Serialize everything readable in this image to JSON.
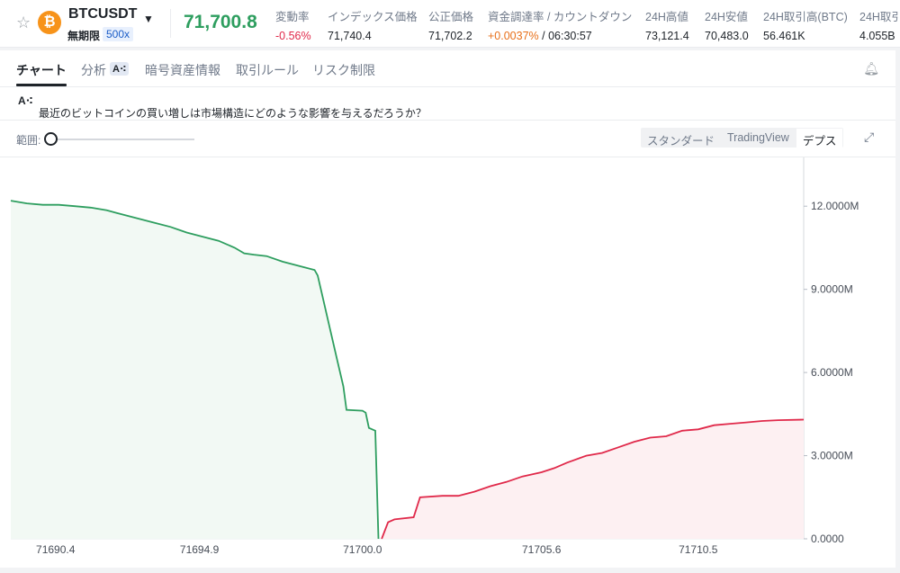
{
  "header": {
    "symbol": "BTCUSDT",
    "contract": "無期限",
    "leverage": "500x",
    "coin_letter": "₿",
    "last_price": "71,700.8",
    "stats": [
      {
        "label": "変動率",
        "value": "-0.56%"
      },
      {
        "label": "インデックス価格",
        "value": "71,740.4"
      },
      {
        "label": "公正価格",
        "value": "71,702.2"
      },
      {
        "label": "資金調達率 / カウントダウン",
        "value": "+0.0037%",
        "value2": " / 06:30:57"
      },
      {
        "label": "24H高値",
        "value": "73,121.4"
      },
      {
        "label": "24H安値",
        "value": "70,483.0"
      },
      {
        "label": "24H取引高(BTC)",
        "value": "56.461K"
      },
      {
        "label": "24H取引",
        "value": "4.055B"
      }
    ]
  },
  "tabs": [
    "チャート",
    "分析",
    "暗号資産情報",
    "取引ルール",
    "リスク制限"
  ],
  "ai_badge": "A⁖",
  "ai_question": "最近のビットコインの買い増しは市場構造にどのような影響を与えるだろうか？",
  "range_label": "範囲:",
  "view_modes": [
    "スタンダード",
    "TradingView",
    "デプス"
  ],
  "active_view": "デプス",
  "colors": {
    "bid": "#2e9e5f",
    "ask": "#e0294a",
    "bid_fill": "#f2f9f4",
    "ask_fill": "#fdf0f2"
  },
  "chart_data": {
    "type": "area",
    "title": "",
    "xlabel": "",
    "ylabel": "",
    "x_ticks": [
      "71690.4",
      "71694.9",
      "71700.0",
      "71705.6",
      "71710.5"
    ],
    "x_tick_values": [
      71690.4,
      71694.9,
      71700.0,
      71705.6,
      71710.5
    ],
    "y_ticks": [
      "0.0000",
      "3.0000M",
      "6.0000M",
      "9.0000M",
      "12.0000M"
    ],
    "xlim": [
      71689.0,
      71713.8
    ],
    "ylim": [
      0,
      13500000
    ],
    "series": [
      {
        "name": "bids",
        "side": "bid",
        "points": [
          [
            71689.0,
            12200000
          ],
          [
            71689.5,
            12100000
          ],
          [
            71690.0,
            12050000
          ],
          [
            71690.5,
            12050000
          ],
          [
            71691.0,
            12000000
          ],
          [
            71691.5,
            11950000
          ],
          [
            71692.0,
            11850000
          ],
          [
            71692.5,
            11700000
          ],
          [
            71693.0,
            11550000
          ],
          [
            71693.5,
            11400000
          ],
          [
            71694.0,
            11250000
          ],
          [
            71694.5,
            11050000
          ],
          [
            71695.0,
            10900000
          ],
          [
            71695.5,
            10750000
          ],
          [
            71696.0,
            10500000
          ],
          [
            71696.3,
            10300000
          ],
          [
            71696.6,
            10250000
          ],
          [
            71697.0,
            10200000
          ],
          [
            71697.5,
            10000000
          ],
          [
            71698.0,
            9850000
          ],
          [
            71698.5,
            9700000
          ],
          [
            71698.6,
            9500000
          ],
          [
            71698.8,
            8500000
          ],
          [
            71699.0,
            7500000
          ],
          [
            71699.2,
            6500000
          ],
          [
            71699.4,
            5500000
          ],
          [
            71699.5,
            4650000
          ],
          [
            71700.0,
            4620000
          ],
          [
            71700.1,
            4550000
          ],
          [
            71700.2,
            4000000
          ],
          [
            71700.4,
            3900000
          ],
          [
            71700.5,
            0
          ]
        ]
      },
      {
        "name": "asks",
        "side": "ask",
        "points": [
          [
            71700.6,
            0
          ],
          [
            71700.8,
            600000
          ],
          [
            71701.0,
            700000
          ],
          [
            71701.6,
            780000
          ],
          [
            71701.8,
            1500000
          ],
          [
            71702.5,
            1550000
          ],
          [
            71703.0,
            1550000
          ],
          [
            71703.5,
            1700000
          ],
          [
            71704.0,
            1900000
          ],
          [
            71704.5,
            2050000
          ],
          [
            71705.0,
            2250000
          ],
          [
            71705.6,
            2400000
          ],
          [
            71706.0,
            2550000
          ],
          [
            71706.4,
            2750000
          ],
          [
            71707.0,
            3000000
          ],
          [
            71707.5,
            3100000
          ],
          [
            71708.0,
            3300000
          ],
          [
            71708.5,
            3500000
          ],
          [
            71709.0,
            3650000
          ],
          [
            71709.5,
            3700000
          ],
          [
            71710.0,
            3900000
          ],
          [
            71710.5,
            3950000
          ],
          [
            71711.0,
            4100000
          ],
          [
            71711.5,
            4150000
          ],
          [
            71712.0,
            4200000
          ],
          [
            71712.5,
            4250000
          ],
          [
            71713.0,
            4280000
          ],
          [
            71713.8,
            4300000
          ]
        ]
      }
    ]
  }
}
